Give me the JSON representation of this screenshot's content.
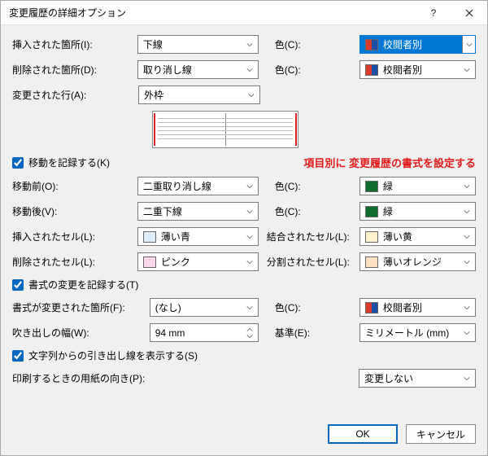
{
  "title": "変更履歴の詳細オプション",
  "note": "項目別に 変更履歴の書式を設定する",
  "labels": {
    "inserted": "挿入された箇所(I):",
    "deleted": "削除された箇所(D):",
    "changedLine": "変更された行(A):",
    "trackMoves": "移動を記録する(K)",
    "moveFrom": "移動前(O):",
    "moveTo": "移動後(V):",
    "insertedCell": "挿入されたセル(L):",
    "deletedCell": "削除されたセル(L):",
    "trackFormatting": "書式の変更を記録する(T)",
    "formatChanged": "書式が変更された箇所(F):",
    "balloonWidth": "吹き出しの幅(W):",
    "showBalloonLines": "文字列からの引き出し線を表示する(S)",
    "printOrientation": "印刷するときの用紙の向き(P):",
    "mergedCell": "結合されたセル(L):",
    "splitCell": "分割されたセル(L):",
    "measure": "基準(E):",
    "color": "色(C):"
  },
  "values": {
    "inserted": "下線",
    "deleted": "取り消し線",
    "changedLine": "外枠",
    "moveFrom": "二重取り消し線",
    "moveTo": "二重下線",
    "insertedCell": "薄い青",
    "deletedCell": "ピンク",
    "formatChanged": "(なし)",
    "balloonWidth": "94 mm",
    "printOrientation": "変更しない",
    "mergedCell": "薄い黄",
    "splitCell": "薄いオレンジ",
    "measure": "ミリメートル (mm)",
    "colorByAuthor": "校閲者別",
    "colorGreen": "緑"
  },
  "colors": {
    "byAuthorRed": "#d93a2b",
    "byAuthorBlue": "#174ea6",
    "green": "#0f6b2e",
    "lightBlue": "#dcecf9",
    "pink": "#ffd8ea",
    "lightYellow": "#fff3cf",
    "lightOrange": "#ffe1c4"
  },
  "buttons": {
    "ok": "OK",
    "cancel": "キャンセル"
  }
}
